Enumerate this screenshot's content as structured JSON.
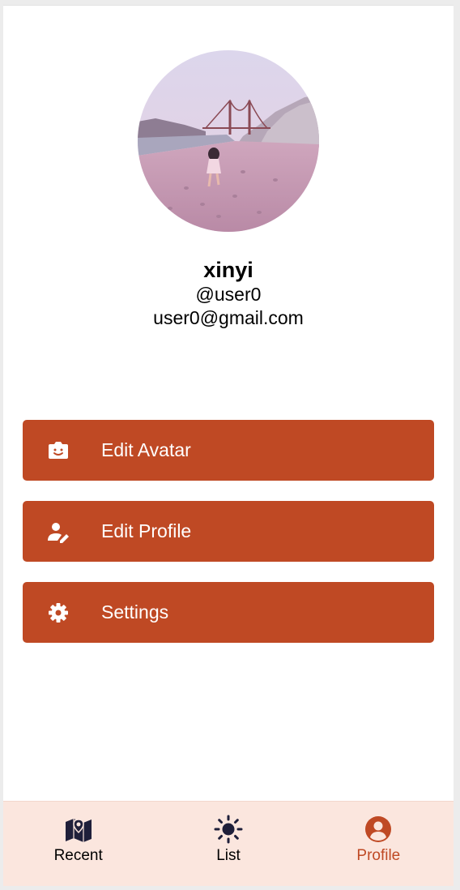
{
  "profile": {
    "name": "xinyi",
    "handle": "@user0",
    "email": "user0@gmail.com"
  },
  "actions": [
    {
      "label": "Edit Avatar",
      "icon": "camera-face-icon"
    },
    {
      "label": "Edit Profile",
      "icon": "person-edit-icon"
    },
    {
      "label": "Settings",
      "icon": "gear-icon"
    }
  ],
  "tabs": [
    {
      "label": "Recent",
      "icon": "map-icon",
      "active": false
    },
    {
      "label": "List",
      "icon": "sun-icon",
      "active": false
    },
    {
      "label": "Profile",
      "icon": "account-circle-icon",
      "active": true
    }
  ],
  "colors": {
    "accent": "#bf4924",
    "tabbar_bg": "#fbe6de",
    "icon_dark": "#1f1f3a"
  }
}
